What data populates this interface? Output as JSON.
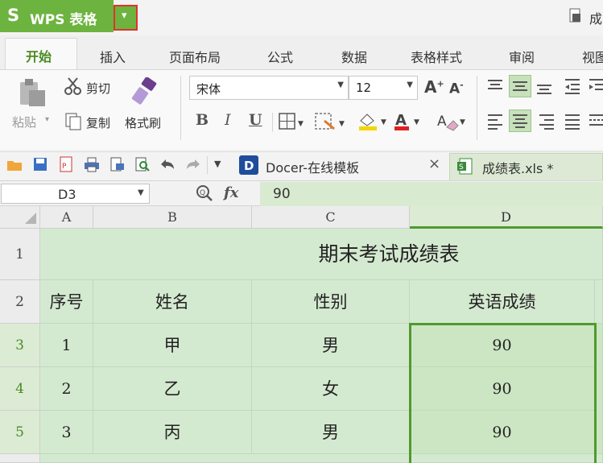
{
  "app": {
    "logo": "S",
    "name": "WPS 表格",
    "dropdown_glyph": "▾",
    "top_right_text": "成"
  },
  "tabs": [
    "开始",
    "插入",
    "页面布局",
    "公式",
    "数据",
    "表格样式",
    "审阅",
    "视图"
  ],
  "ribbon": {
    "paste": "粘贴",
    "cut": "剪切",
    "copy": "复制",
    "format_painter": "格式刷",
    "font_name": "宋体",
    "font_size": "12",
    "bold": "B",
    "italic": "I",
    "underline": "U"
  },
  "quickbar": {
    "doc_tab": "Docer-在线模板",
    "close_glyph": "×",
    "file_tab": "成绩表.xls *"
  },
  "formula_bar": {
    "cell_ref": "D3",
    "fx": "fx",
    "value": "90"
  },
  "grid": {
    "columns": [
      "A",
      "B",
      "C",
      "D"
    ],
    "rows": [
      "1",
      "2",
      "3",
      "4",
      "5"
    ],
    "title": "期末考试成绩表",
    "headers": [
      "序号",
      "姓名",
      "性别",
      "英语成绩"
    ],
    "data": [
      [
        "1",
        "甲",
        "男",
        "90"
      ],
      [
        "2",
        "乙",
        "女",
        "90"
      ],
      [
        "3",
        "丙",
        "男",
        "90"
      ]
    ]
  },
  "colors": {
    "accent": "#6db33f",
    "selection": "#4f9a2e",
    "grid_bg": "#d4ead0",
    "highlight": "#e0322b"
  }
}
